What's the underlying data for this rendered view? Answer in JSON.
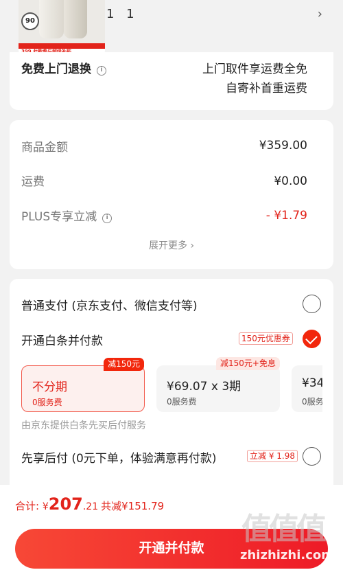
{
  "product": {
    "thumb_badge": "90",
    "thumb_price": "399",
    "thumb_caption": "此款参与超级补贴",
    "quantity_text": "1 1",
    "arrow": "›"
  },
  "return_service": {
    "title": "免费上门退换",
    "line1": "上门取件享运费全免",
    "line2": "自寄补首重运费"
  },
  "price": {
    "goods_label": "商品金额",
    "goods_value": "¥359.00",
    "shipping_label": "运费",
    "shipping_value": "¥0.00",
    "plus_label": "PLUS专享立减",
    "plus_value": "- ¥1.79",
    "expand_label": "展开更多 ›"
  },
  "payment": {
    "option1_label": "普通支付 (京东支付、微信支付等)",
    "option2_label": "开通白条并付款",
    "option2_coupon": "150元优惠券",
    "plans": [
      {
        "main": "不分期",
        "fee": "0服务费",
        "badge": "减150元"
      },
      {
        "main": "¥69.07 x 3期",
        "fee": "0服务费",
        "badge": "减150元+免息"
      },
      {
        "main": "¥34",
        "fee": "0服务"
      }
    ],
    "provider_note": "由京东提供白条先买后付服务",
    "option3_label": "先享后付 (0元下单，体验满意再付款)",
    "option3_tag": "立减 ¥ 1.98"
  },
  "summary": {
    "total_label": "合计: ",
    "currency": "¥",
    "total_int": "207",
    "total_dec": ".21",
    "saved": "共减¥151.79",
    "pay_button": "开通并付款"
  },
  "watermark": {
    "mark": "值值值",
    "site": "zhizhizhi.com"
  },
  "colors": {
    "accent": "#e2231a",
    "button": "#f2270c"
  }
}
